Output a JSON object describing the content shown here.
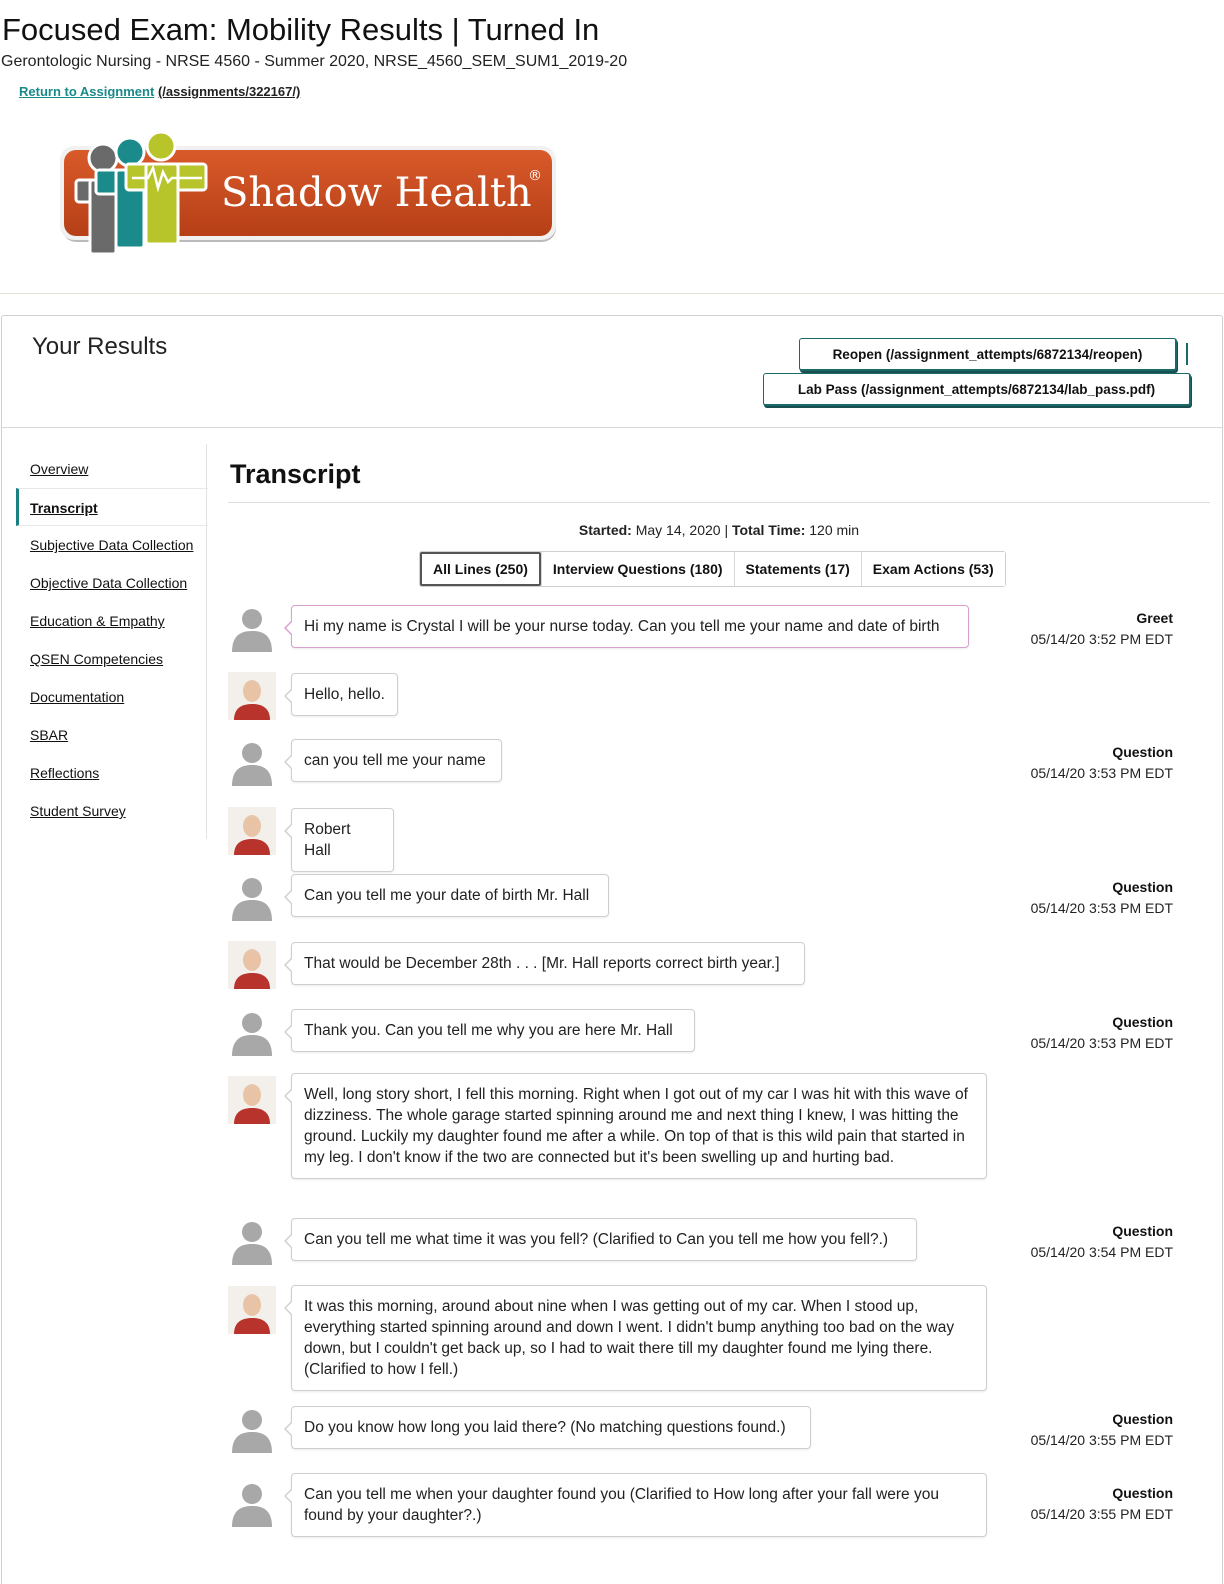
{
  "header": {
    "title": "Focused Exam: Mobility Results | Turned In",
    "course": "Gerontologic Nursing - NRSE 4560 - Summer 2020, NRSE_4560_SEM_SUM1_2019-20",
    "return_link_label": "Return to Assignment",
    "return_link_url": "(/assignments/322167/)"
  },
  "logo": {
    "text": "Shadow Health",
    "mark": "®"
  },
  "results": {
    "title": "Your Results",
    "reopen_label": "Reopen (/assignment_attempts/6872134/reopen)",
    "labpass_label": "Lab Pass (/assignment_attempts/6872134/lab_pass.pdf)"
  },
  "sidenav": {
    "items": [
      {
        "label": "Overview",
        "active": false
      },
      {
        "label": "Transcript",
        "active": true
      },
      {
        "label": "Subjective Data Collection",
        "active": false
      },
      {
        "label": "Objective Data Collection",
        "active": false
      },
      {
        "label": "Education & Empathy",
        "active": false
      },
      {
        "label": "QSEN Competencies",
        "active": false
      },
      {
        "label": "Documentation",
        "active": false
      },
      {
        "label": "SBAR",
        "active": false
      },
      {
        "label": "Reflections",
        "active": false
      },
      {
        "label": "Student Survey",
        "active": false
      }
    ]
  },
  "transcript": {
    "title": "Transcript",
    "started_label": "Started:",
    "started_value": "May 14, 2020",
    "separator": "|",
    "total_label": "Total Time:",
    "total_value": "120 min",
    "tabs": [
      {
        "label": "All Lines (250)",
        "active": true
      },
      {
        "label": "Interview Questions (180)",
        "active": false
      },
      {
        "label": "Statements (17)",
        "active": false
      },
      {
        "label": "Exam Actions (53)",
        "active": false
      }
    ],
    "messages": [
      {
        "speaker": "student",
        "text": "Hi my name is Crystal I will be your nurse today. Can you tell me your name and date of birth",
        "type": "Greet",
        "time": "05/14/20 3:52 PM EDT"
      },
      {
        "speaker": "patient",
        "text": "Hello, hello.",
        "type": "",
        "time": ""
      },
      {
        "speaker": "student",
        "text": "can you tell me your name",
        "type": "Question",
        "time": "05/14/20 3:53 PM EDT"
      },
      {
        "speaker": "patient",
        "text": "Robert Hall",
        "type": "",
        "time": ""
      },
      {
        "speaker": "student",
        "text": "Can you tell me your date of birth Mr. Hall",
        "type": "Question",
        "time": "05/14/20 3:53 PM EDT"
      },
      {
        "speaker": "patient",
        "text": "That would be December 28th . . . [Mr. Hall reports correct birth year.]",
        "type": "",
        "time": ""
      },
      {
        "speaker": "student",
        "text": "Thank you. Can you tell me why you are here Mr. Hall",
        "type": "Question",
        "time": "05/14/20 3:53 PM EDT"
      },
      {
        "speaker": "patient",
        "text": "Well, long story short, I fell this morning. Right when I got out of my car I was hit with this wave of dizziness. The whole garage started spinning around me and next thing I knew, I was hitting the ground. Luckily my daughter found me after a while. On top of that is this wild pain that started in my leg. I don't know if the two are connected but it's been swelling up and hurting bad.",
        "type": "",
        "time": ""
      },
      {
        "speaker": "student",
        "text": "Can you tell me what time it was you fell? (Clarified to Can you tell me how you fell?.)",
        "type": "Question",
        "time": "05/14/20 3:54 PM EDT"
      },
      {
        "speaker": "patient",
        "text": "It was this morning, around about nine when I was getting out of my car. When I stood up, everything started spinning around and down I went. I didn't bump anything too bad on the way down, but I couldn't get back up, so I had to wait there till my daughter found me lying there. (Clarified to how I fell.)",
        "type": "",
        "time": ""
      },
      {
        "speaker": "student",
        "text": "Do you know how long you laid there? (No matching questions found.)",
        "type": "Question",
        "time": "05/14/20 3:55 PM EDT"
      },
      {
        "speaker": "student",
        "text": "Can you tell me when your daughter found you (Clarified to How long after your fall were you found by your daughter?.)",
        "type": "Question",
        "time": "05/14/20 3:55 PM EDT"
      }
    ]
  },
  "colors": {
    "accent": "#1b8080",
    "logo_orange": "#cc4a1e",
    "logo_teal": "#1a8a8a",
    "logo_lime": "#b7c42a",
    "greet_border": "#d9a0cf"
  }
}
